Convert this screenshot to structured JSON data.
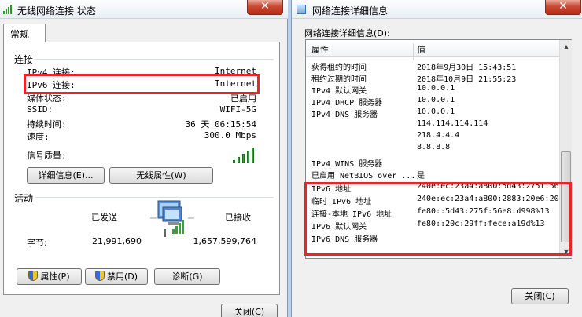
{
  "left_window": {
    "title": "无线网络连接 状态",
    "close_glyph": "✕",
    "tab": "常规",
    "connection": {
      "section_title": "连接",
      "rows": [
        {
          "label": "IPv4 连接:",
          "value": "Internet"
        },
        {
          "label": "IPv6 连接:",
          "value": "Internet"
        },
        {
          "label": "媒体状态:",
          "value": "已启用"
        },
        {
          "label": "SSID:",
          "value": "WIFI-5G"
        },
        {
          "label": "持续时间:",
          "value": "36 天 06:15:54"
        },
        {
          "label": "速度:",
          "value": "300.0 Mbps"
        }
      ],
      "signal_label": "信号质量:",
      "signal_bars_active": 5,
      "signal_bars_total": 5,
      "details_button": "详细信息(E)...",
      "wireless_props_button": "无线属性(W)"
    },
    "activity": {
      "section_title": "活动",
      "sent_label": "已发送",
      "received_label": "已接收",
      "bytes_label": "字节:",
      "bytes_sent": "21,991,690",
      "bytes_received": "1,657,599,764"
    },
    "buttons": {
      "properties": "属性(P)",
      "disable": "禁用(D)",
      "diagnose": "诊断(G)",
      "close": "关闭(C)"
    }
  },
  "right_window": {
    "title": "网络连接详细信息",
    "close_glyph": "✕",
    "details_label": "网络连接详细信息(D):",
    "columns": {
      "property": "属性",
      "value": "值"
    },
    "rows": [
      {
        "property": "获得租约的时间",
        "value": "2018年9月30日 15:43:51"
      },
      {
        "property": "租约过期的时间",
        "value": "2018年10月9日 21:55:23"
      },
      {
        "property": "IPv4 默认网关",
        "value": "10.0.0.1"
      },
      {
        "property": "IPv4 DHCP 服务器",
        "value": "10.0.0.1"
      },
      {
        "property": "IPv4 DNS 服务器",
        "value": "10.0.0.1"
      },
      {
        "property": "",
        "value": "114.114.114.114"
      },
      {
        "property": "",
        "value": "218.4.4.4"
      },
      {
        "property": "",
        "value": "8.8.8.8"
      },
      {
        "property": "IPv4 WINS 服务器",
        "value": ""
      },
      {
        "property": "已启用 NetBIOS over ...",
        "value": "是"
      },
      {
        "property": "IPv6 地址",
        "value": "240e:ec:23a4:a800:5d43:275f:56"
      },
      {
        "property": "临时 IPv6 地址",
        "value": "240e:ec:23a4:a800:2883:20e6:20"
      },
      {
        "property": "连接-本地 IPv6 地址",
        "value": "fe80::5d43:275f:56e8:d998%13"
      },
      {
        "property": "IPv6 默认网关",
        "value": "fe80::20c:29ff:fece:a19d%13"
      },
      {
        "property": "IPv6 DNS 服务器",
        "value": ""
      }
    ],
    "close_button": "关闭(C)"
  },
  "colors": {
    "highlight_box": "#e8262a",
    "signal_green": "#2fa82f"
  }
}
